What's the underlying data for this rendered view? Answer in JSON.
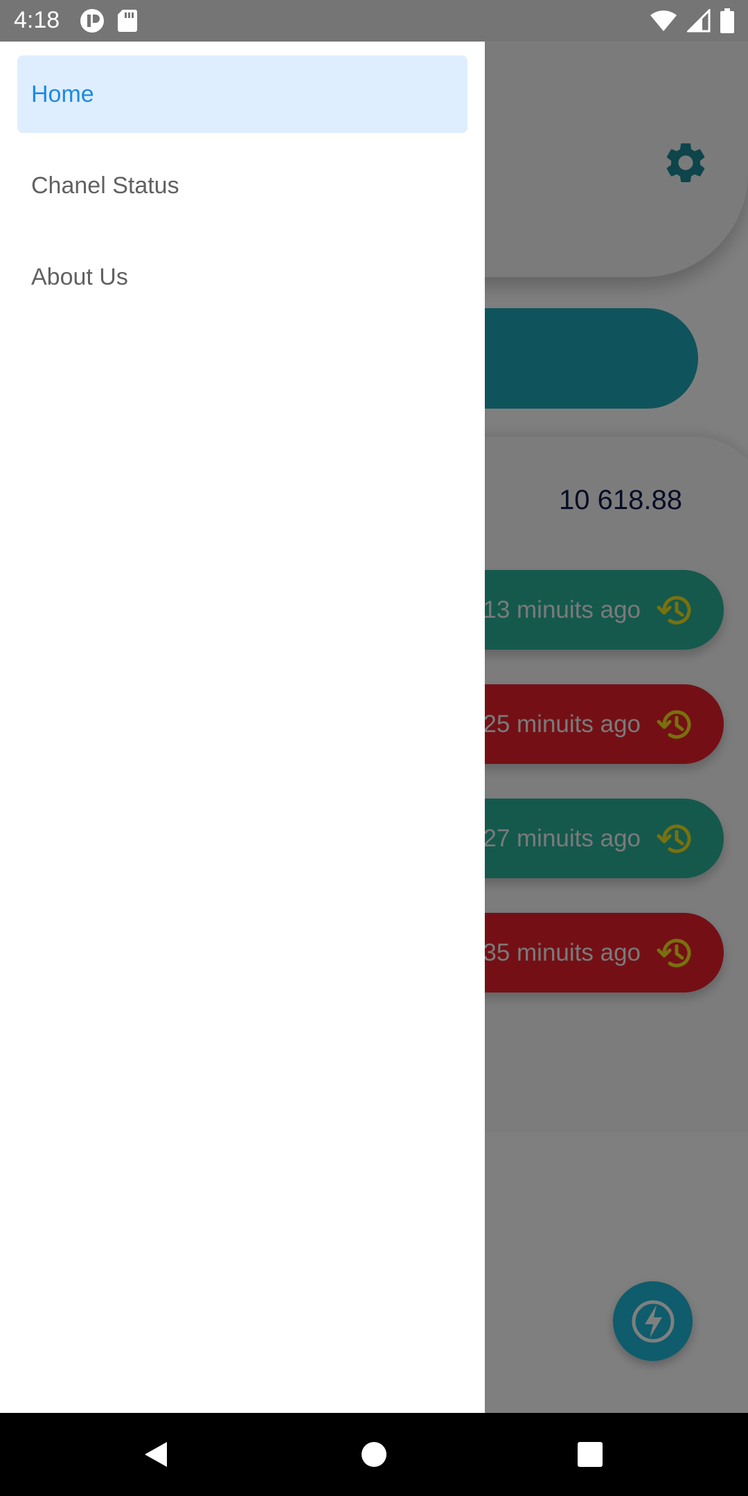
{
  "status_bar": {
    "time": "4:18",
    "left_icons": [
      "app-notification-icon",
      "sd-card-icon"
    ],
    "right_icons": [
      "wifi-icon",
      "cell-signal-icon",
      "battery-icon"
    ]
  },
  "drawer": {
    "items": [
      {
        "label": "Home",
        "active": true
      },
      {
        "label": "Chanel Status",
        "active": false
      },
      {
        "label": "About Us",
        "active": false
      }
    ]
  },
  "background_app": {
    "settings_icon": "gear-icon",
    "balance": "10 618.88",
    "history": [
      {
        "text": "13 minuits ago",
        "color": "#2bb39a"
      },
      {
        "text": "25 minuits ago",
        "color": "#e8212b"
      },
      {
        "text": "27 minuits ago",
        "color": "#2bb39a"
      },
      {
        "text": "35 minuits ago",
        "color": "#e8212b"
      }
    ],
    "fab_icon": "lightning-icon"
  },
  "nav_bar": {
    "buttons": [
      "back-icon",
      "home-icon",
      "recents-icon"
    ]
  },
  "colors": {
    "accent_teal": "#1fa9b8",
    "drawer_active_bg": "#deeefe",
    "drawer_active_text": "#1e88e5"
  }
}
